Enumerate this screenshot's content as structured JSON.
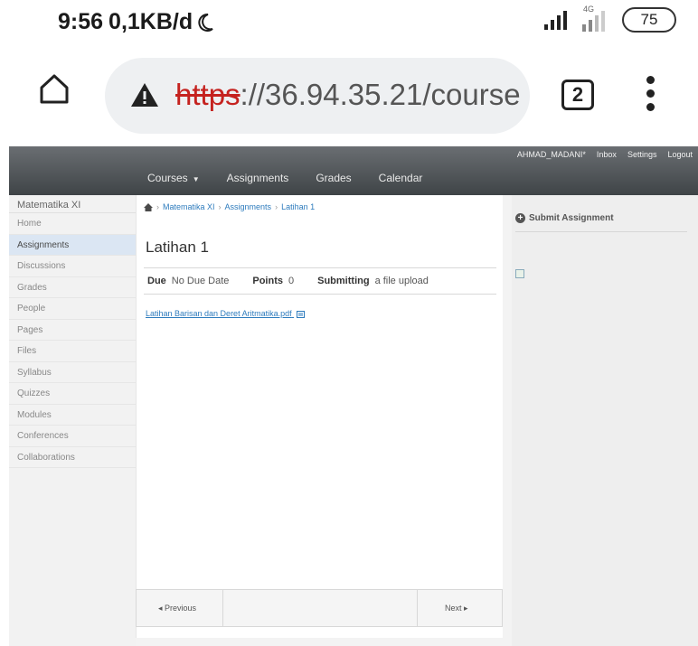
{
  "status_bar": {
    "time": "9:56",
    "speed": "0,1KB/d",
    "network": "4G",
    "battery": "75"
  },
  "browser": {
    "url_scheme": "https",
    "url_rest": "://36.94.35.21/course",
    "tab_count": "2"
  },
  "top_nav": {
    "user": "AHMAD_MADANI*",
    "inbox": "Inbox",
    "settings": "Settings",
    "logout": "Logout",
    "courses": "Courses",
    "assignments": "Assignments",
    "grades": "Grades",
    "calendar": "Calendar"
  },
  "sidebar": {
    "course": "Matematika XI",
    "items": [
      {
        "label": "Home"
      },
      {
        "label": "Assignments"
      },
      {
        "label": "Discussions"
      },
      {
        "label": "Grades"
      },
      {
        "label": "People"
      },
      {
        "label": "Pages"
      },
      {
        "label": "Files"
      },
      {
        "label": "Syllabus"
      },
      {
        "label": "Quizzes"
      },
      {
        "label": "Modules"
      },
      {
        "label": "Conferences"
      },
      {
        "label": "Collaborations"
      }
    ]
  },
  "breadcrumb": {
    "course": "Matematika XI",
    "section": "Assignments",
    "page": "Latihan 1"
  },
  "assignment": {
    "title": "Latihan 1",
    "due_label": "Due",
    "due_value": "No Due Date",
    "points_label": "Points",
    "points_value": "0",
    "submitting_label": "Submitting",
    "submitting_value": "a file upload",
    "file_name": "Latihan Barisan dan Deret Aritmatika.pdf"
  },
  "pager": {
    "prev": "◂ Previous",
    "next": "Next ▸"
  },
  "right": {
    "submit": "Submit Assignment"
  },
  "colors": {
    "link": "#2d7bbd",
    "nav_bg": "#4a4f53",
    "active_item": "#dbe6f3",
    "url_warning": "#c5221f"
  }
}
